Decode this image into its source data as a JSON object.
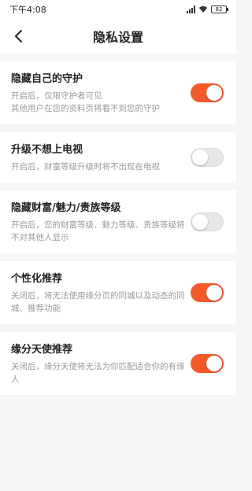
{
  "status_bar": {
    "time": "下午4:08",
    "battery": "82"
  },
  "nav": {
    "title": "隐私设置"
  },
  "colors": {
    "accent": "#f35a2b",
    "off": "#e6e6e6"
  },
  "settings": [
    {
      "title": "隐藏自己的守护",
      "desc": "开启后，仅限守护者可见\n其他用户在您的资料页将看不到您的守护",
      "on": true
    },
    {
      "title": "升级不想上电视",
      "desc": "开启后，财富等级升级时将不出现在电视",
      "on": false
    },
    {
      "title": "隐藏财富/魅力/贵族等级",
      "desc": "开启后，您的财富等级、魅力等级、贵族等级将不对其他人显示",
      "on": false
    },
    {
      "title": "个性化推荐",
      "desc": "关闭后，将无法使用缘分页的同城以及动态的同城、推荐功能",
      "on": true
    },
    {
      "title": "缘分天使推荐",
      "desc": "关闭后，缘分天使将无法为你匹配适合你的有缘人",
      "on": true
    }
  ]
}
